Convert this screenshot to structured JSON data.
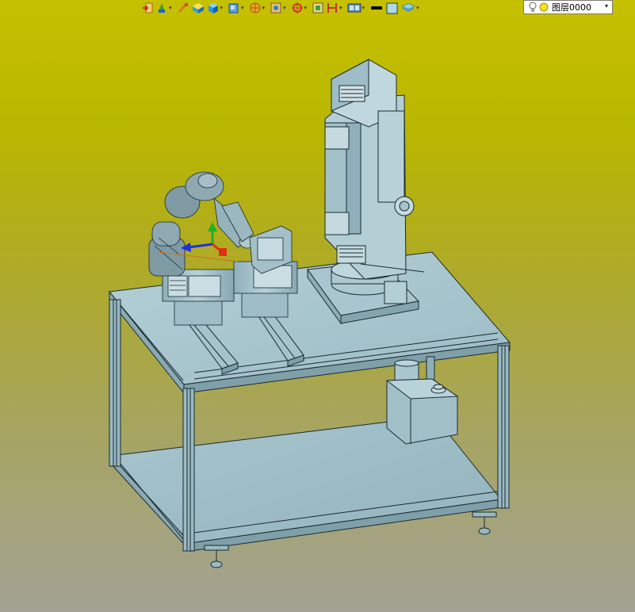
{
  "toolbar": {
    "tools": [
      {
        "icon": "export-icon"
      },
      {
        "icon": "sketch-pen-icon"
      },
      {
        "icon": "edit-icon"
      },
      {
        "icon": "solid-box-icon"
      },
      {
        "icon": "blue-cube-icon"
      },
      {
        "icon": "view-cube-icon"
      },
      {
        "icon": "render-style-icon"
      },
      {
        "icon": "zoom-fit-icon"
      },
      {
        "icon": "origin-icon"
      },
      {
        "icon": "section-icon"
      },
      {
        "icon": "dimension-icon"
      },
      {
        "icon": "display-options-icon"
      },
      {
        "icon": "line-color-icon"
      },
      {
        "icon": "face-color-icon"
      },
      {
        "icon": "layer-manager-icon"
      }
    ]
  },
  "layer": {
    "current": "图层0000"
  },
  "scene": {
    "colors": {
      "background_top": "#c5c000",
      "background_bottom": "#a3a294",
      "model": "#9fbfc8",
      "edge": "#1a2a30",
      "axis_x": "#e03010",
      "axis_y": "#20b020",
      "axis_z": "#2030e0"
    }
  }
}
